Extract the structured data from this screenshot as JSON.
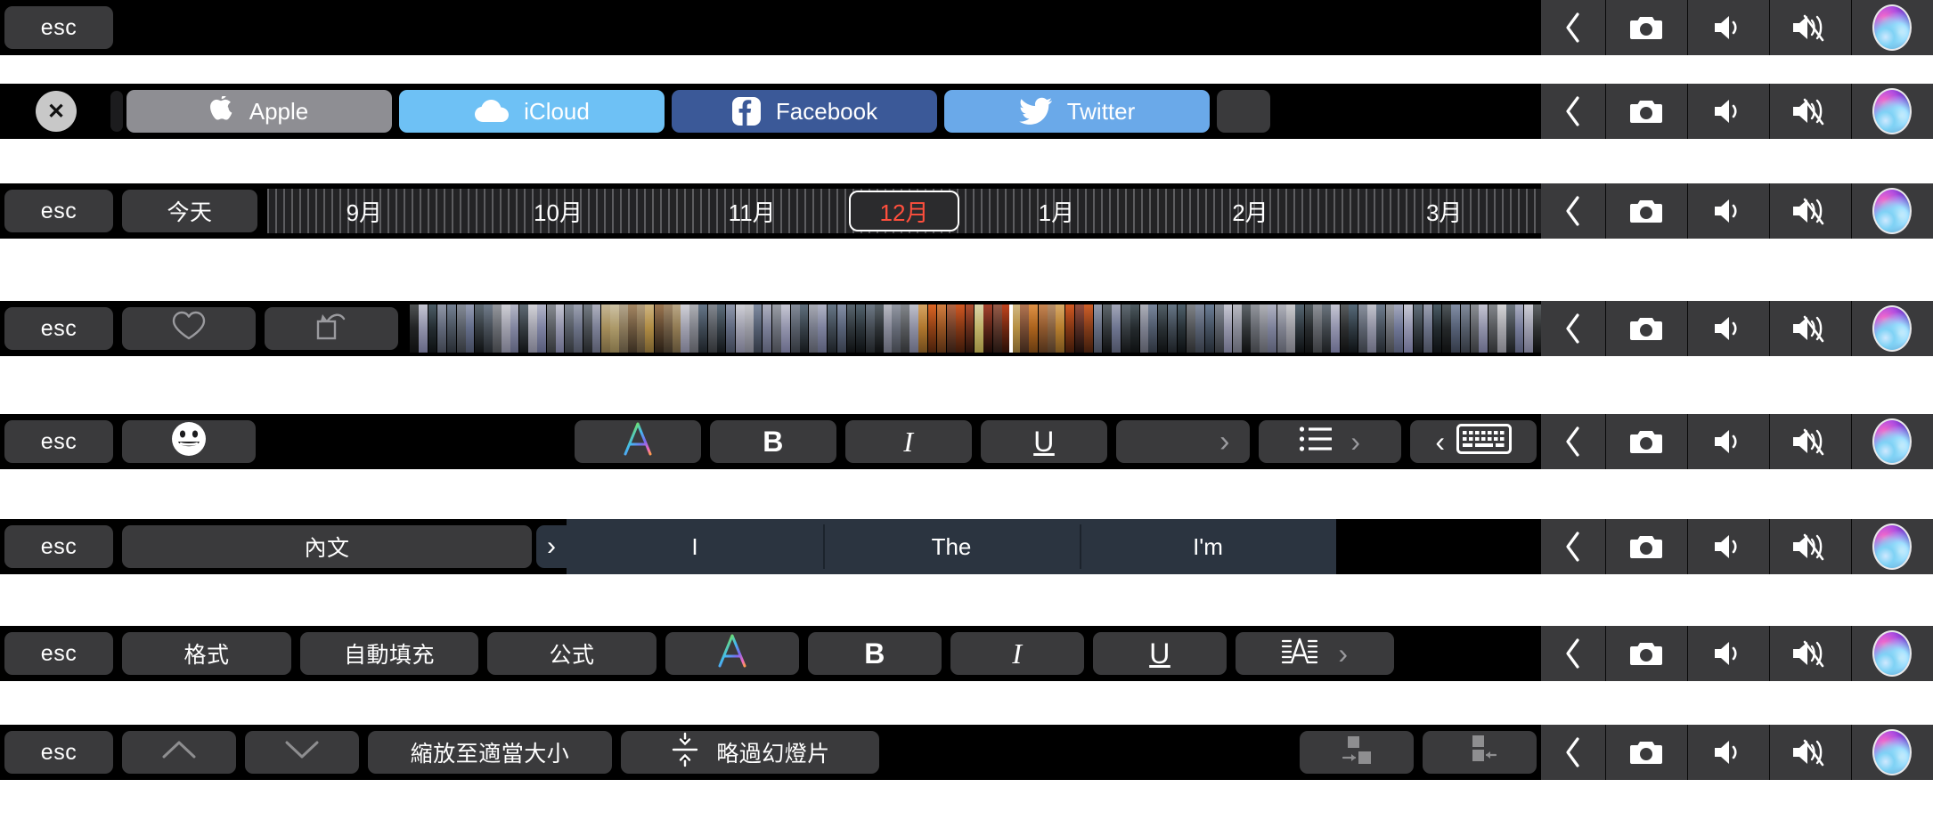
{
  "common": {
    "esc_label": "esc",
    "control_strip": [
      {
        "name": "expand-control-strip",
        "icon": "chevron-left-icon"
      },
      {
        "name": "screenshot",
        "icon": "camera-icon"
      },
      {
        "name": "volume-up",
        "icon": "speaker-volume-icon"
      },
      {
        "name": "mute",
        "icon": "speaker-mute-icon"
      },
      {
        "name": "siri",
        "icon": "siri-orb-icon"
      }
    ]
  },
  "rows": [
    {
      "id": "row-blank",
      "description": "empty touch bar with esc only",
      "esc": "esc"
    },
    {
      "id": "row-social",
      "close_label": "✕",
      "apps": [
        {
          "label": "Apple",
          "icon": "apple-logo-icon",
          "bg": "#8e8e93"
        },
        {
          "label": "iCloud",
          "icon": "icloud-cloud-icon",
          "bg": "#6ec1f5"
        },
        {
          "label": "Facebook",
          "icon": "facebook-f-icon",
          "bg": "#3b5998"
        },
        {
          "label": "Twitter",
          "icon": "twitter-bird-icon",
          "bg": "#6aa9e9"
        }
      ]
    },
    {
      "id": "row-calendar",
      "esc": "esc",
      "today_label": "今天",
      "months": [
        "9月",
        "10月",
        "11月",
        "12月",
        "1月",
        "2月",
        "3月"
      ],
      "selected_month": "12月",
      "selected_color": "#ff4f3d"
    },
    {
      "id": "row-photos",
      "esc": "esc",
      "favorite_icon": "heart-icon",
      "rotate_icon": "rotate-icon",
      "filmstrip_label": "photo-filmstrip"
    },
    {
      "id": "row-text-format",
      "esc": "esc",
      "emoji_icon": "smiley-face-icon",
      "color_label": "A",
      "bold_label": "B",
      "italic_label": "I",
      "underline_label": "U",
      "more_chevron": "›",
      "list_icon": "bullet-list-icon",
      "list_chevron": "›",
      "keyboard_chevron": "‹",
      "keyboard_icon": "keyboard-icon"
    },
    {
      "id": "row-predictive",
      "esc": "esc",
      "style_label": "內文",
      "expand_chevron": "›",
      "suggestions": [
        "I",
        "The",
        "I'm"
      ]
    },
    {
      "id": "row-spreadsheet",
      "esc": "esc",
      "format_label": "格式",
      "autofill_label": "自動填充",
      "formula_label": "公式",
      "color_label": "A",
      "bold_label": "B",
      "italic_label": "I",
      "underline_label": "U",
      "align_icon": "text-align-icon",
      "more_chevron": "›"
    },
    {
      "id": "row-keynote",
      "esc": "esc",
      "prev_icon": "chevron-up-icon",
      "next_icon": "chevron-down-icon",
      "zoom_fit_label": "縮放至適當大小",
      "skip_slide_label": "略過幻燈片",
      "skip_icon": "skip-slide-icon",
      "group_icon": "group-right-icon",
      "ungroup_icon": "group-left-icon"
    }
  ]
}
